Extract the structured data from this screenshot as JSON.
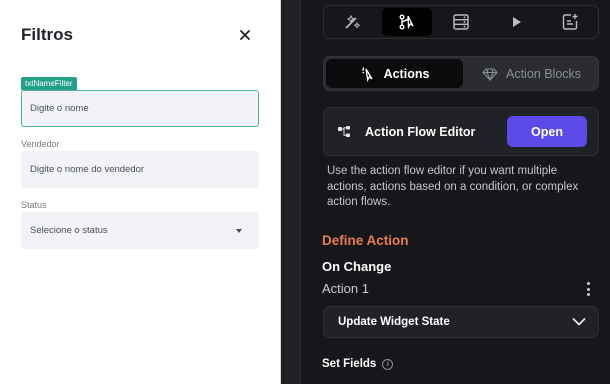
{
  "colors": {
    "accent_teal": "#23a08a",
    "primary_purple": "#5b4ae8",
    "section_orange": "#e97d52",
    "panel_dark": "#16171a"
  },
  "filter_panel": {
    "title": "Filtros",
    "name_field": {
      "tag": "txtNameFilter",
      "placeholder": "Digite o nome"
    },
    "seller_field": {
      "label": "Vendedor",
      "placeholder": "Digite o nome do vendedor"
    },
    "status_field": {
      "label": "Status",
      "placeholder": "Selecione o status"
    }
  },
  "toolbar": {
    "tools": [
      {
        "icon": "magic-wand-icon",
        "active": false
      },
      {
        "icon": "action-flow-icon",
        "active": true
      },
      {
        "icon": "backend-query-icon",
        "active": false
      },
      {
        "icon": "play-icon",
        "active": false
      },
      {
        "icon": "document-icon",
        "active": false
      }
    ]
  },
  "segments": {
    "actions_label": "Actions",
    "blocks_label": "Action Blocks"
  },
  "action_flow": {
    "title": "Action Flow Editor",
    "open_label": "Open",
    "description": "Use the action flow editor if you want multiple actions, actions based on a condition, or complex action flows."
  },
  "define": {
    "heading": "Define Action",
    "trigger": "On Change",
    "action_label": "Action 1",
    "action_value": "Update Widget State",
    "set_fields": "Set Fields"
  }
}
